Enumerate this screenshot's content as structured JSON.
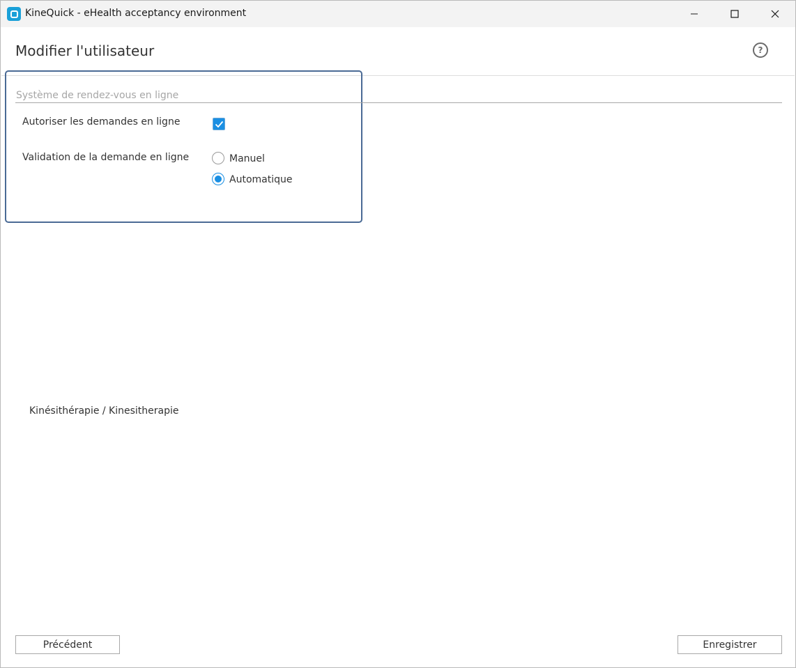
{
  "window": {
    "title": "KineQuick - eHealth acceptancy environment",
    "icon": "kinequick-app-icon",
    "controls": [
      "minimize-icon",
      "maximize-icon",
      "close-icon"
    ]
  },
  "header": {
    "title": "Modifier l'utilisateur",
    "help_label": "?"
  },
  "section": {
    "title": "Système de rendez-vous en ligne",
    "allow_online_label": "Autoriser les demandes en ligne",
    "allow_online_checked": true,
    "validation_label": "Validation de la demande en ligne",
    "validation_options": [
      {
        "label": "Manuel",
        "selected": false
      },
      {
        "label": "Automatique",
        "selected": true
      }
    ]
  },
  "specialty": "Kinésithérapie / Kinesitherapie",
  "footer": {
    "previous_label": "Précédent",
    "save_label": "Enregistrer"
  },
  "colors": {
    "accent": "#1a8fe3",
    "highlight_border": "#4a6a95",
    "section_title": "#a6a6a6"
  }
}
